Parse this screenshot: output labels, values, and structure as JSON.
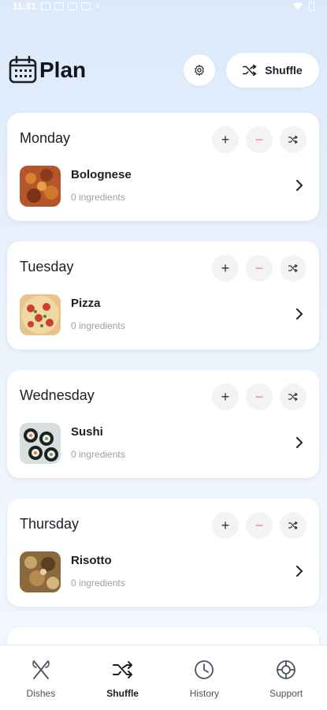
{
  "status_bar": {
    "time": "11:31"
  },
  "header": {
    "title": "Plan",
    "calendar_icon": "calendar-icon",
    "settings_icon": "gear-icon",
    "shuffle_label": "Shuffle",
    "shuffle_icon": "shuffle-icon"
  },
  "days": [
    {
      "day": "Monday",
      "dish": "Bolognese",
      "ingredients": "0 ingredients",
      "image_color": "#b5562a"
    },
    {
      "day": "Tuesday",
      "dish": "Pizza",
      "ingredients": "0 ingredients",
      "image_color": "#e9c38a"
    },
    {
      "day": "Wednesday",
      "dish": "Sushi",
      "ingredients": "0 ingredients",
      "image_color": "#2b2f2e"
    },
    {
      "day": "Thursday",
      "dish": "Risotto",
      "ingredients": "0 ingredients",
      "image_color": "#8a6a3c"
    }
  ],
  "bottom_nav": [
    {
      "label": "Dishes",
      "icon": "fork-knife-icon"
    },
    {
      "label": "Shuffle",
      "icon": "shuffle-icon",
      "active": true
    },
    {
      "label": "History",
      "icon": "clock-icon"
    },
    {
      "label": "Support",
      "icon": "lifebuoy-icon"
    }
  ],
  "colors": {
    "background_top": "#dce9fb",
    "card": "#ffffff",
    "minus_accent": "#f08080",
    "muted_text": "#9aa0a8"
  }
}
